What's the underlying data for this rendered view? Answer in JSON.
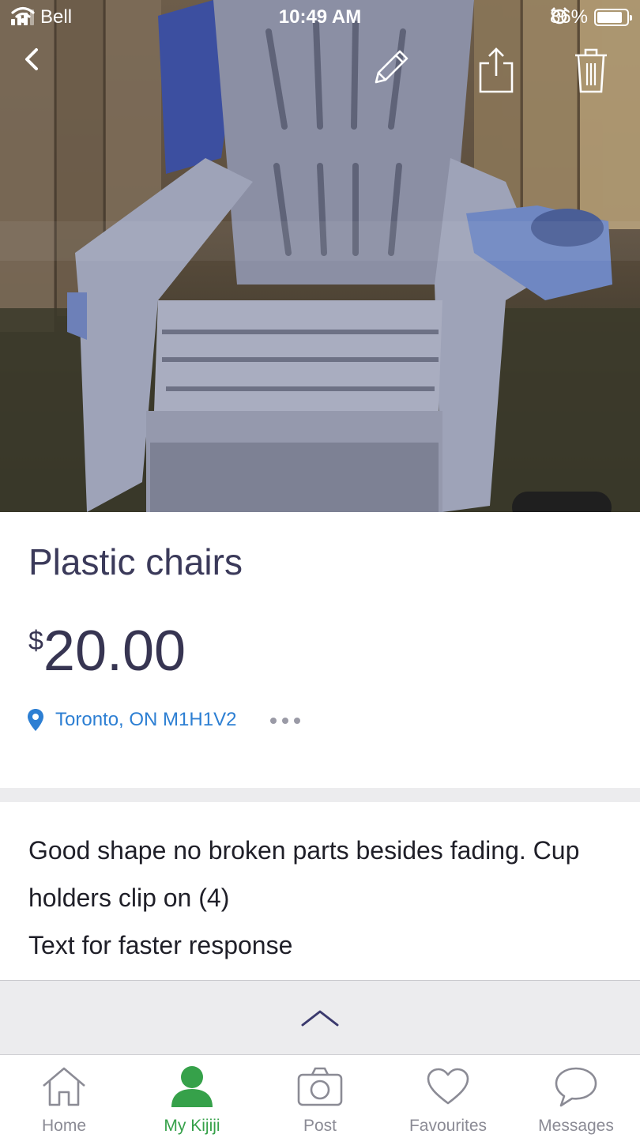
{
  "status_bar": {
    "carrier": "Bell",
    "time": "10:49 AM",
    "battery_percent": "86%",
    "battery_level": 0.86
  },
  "top_actions": {
    "icons": [
      "back-chevron-icon",
      "edit-pencil-icon",
      "share-icon",
      "trash-icon"
    ]
  },
  "listing": {
    "title": "Plastic chairs",
    "price_currency": "$",
    "price_amount": "20.00",
    "location": "Toronto, ON M1H1V2",
    "description_lines": [
      "Good shape no broken parts besides fading. Cup holders clip on (4)",
      "Text for faster response"
    ]
  },
  "tab_bar": {
    "items": [
      {
        "label": "Home",
        "icon": "home-icon",
        "active": false
      },
      {
        "label": "My Kijiji",
        "icon": "person-icon",
        "active": true
      },
      {
        "label": "Post",
        "icon": "camera-icon",
        "active": false
      },
      {
        "label": "Favourites",
        "icon": "heart-icon",
        "active": false
      },
      {
        "label": "Messages",
        "icon": "chat-bubble-icon",
        "active": false
      }
    ]
  },
  "colors": {
    "accent_green": "#36a14a",
    "link_blue": "#2d7fd3",
    "title_text": "#3b3a5a",
    "inactive_gray": "#8b8b95"
  }
}
